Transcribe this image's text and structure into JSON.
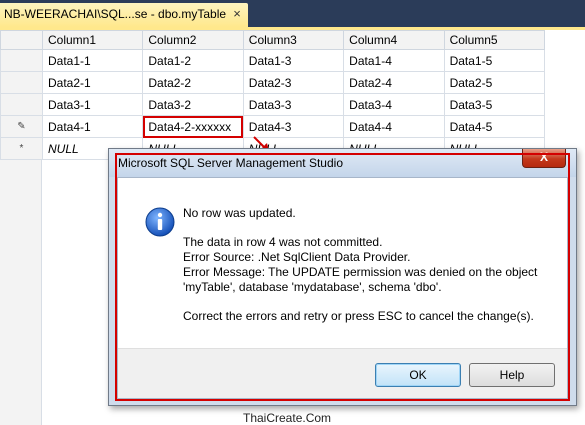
{
  "tab": {
    "title": "NB-WEERACHAI\\SQL...se - dbo.myTable",
    "close_glyph": "×"
  },
  "grid": {
    "columns": [
      "Column1",
      "Column2",
      "Column3",
      "Column4",
      "Column5"
    ],
    "rows": [
      {
        "marker": "",
        "cells": [
          "Data1-1",
          "Data1-2",
          "Data1-3",
          "Data1-4",
          "Data1-5"
        ]
      },
      {
        "marker": "",
        "cells": [
          "Data2-1",
          "Data2-2",
          "Data2-3",
          "Data2-4",
          "Data2-5"
        ]
      },
      {
        "marker": "",
        "cells": [
          "Data3-1",
          "Data3-2",
          "Data3-3",
          "Data3-4",
          "Data3-5"
        ]
      },
      {
        "marker": "✎",
        "cells": [
          "Data4-1",
          "Data4-2-xxxxxx",
          "Data4-3",
          "Data4-4",
          "Data4-5"
        ]
      },
      {
        "marker": "*",
        "cells": [
          "NULL",
          "NULL",
          "NULL",
          "NULL",
          "NULL"
        ]
      }
    ]
  },
  "dialog": {
    "title": "Microsoft SQL Server Management Studio",
    "close_glyph": "X",
    "heading": "No row was updated.",
    "line1": "The data in row 4 was not committed.",
    "line2": "Error Source: .Net SqlClient Data Provider.",
    "line3": "Error Message: The UPDATE permission was denied on the object",
    "line4": "'myTable', database 'mydatabase', schema 'dbo'.",
    "line5": "Correct the errors and retry or press ESC to cancel the change(s).",
    "ok_label": "OK",
    "help_label": "Help"
  },
  "icons": {
    "dialog_icon": "info-icon",
    "edit_marker": "pencil-icon",
    "new_row_marker": "asterisk-icon"
  },
  "colors": {
    "highlight_red": "#d40000",
    "tab_active": "#ffe88c",
    "tabstrip": "#2b3c59"
  },
  "watermark": "ThaiCreate.Com"
}
